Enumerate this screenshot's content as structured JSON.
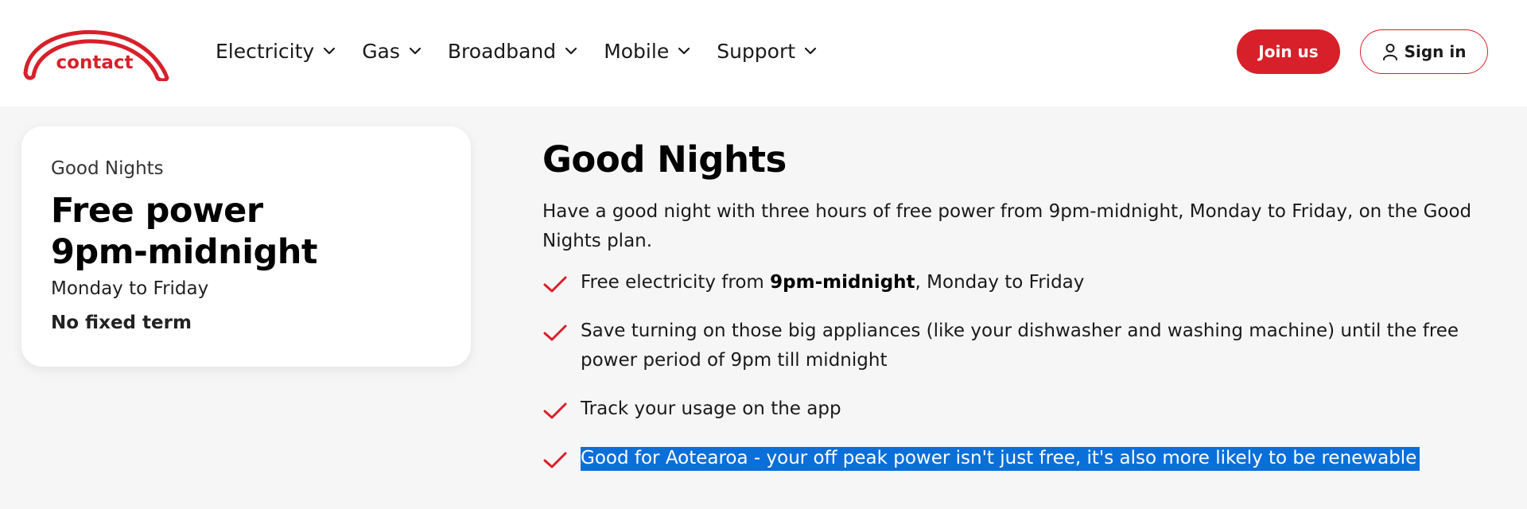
{
  "brand": {
    "logo_text": "contact",
    "accent": "#d8202a"
  },
  "nav": {
    "items": [
      {
        "label": "Electricity",
        "icon": "chevron-down-icon"
      },
      {
        "label": "Gas",
        "icon": "chevron-down-icon"
      },
      {
        "label": "Broadband",
        "icon": "chevron-down-icon"
      },
      {
        "label": "Mobile",
        "icon": "chevron-down-icon"
      },
      {
        "label": "Support",
        "icon": "chevron-down-icon"
      }
    ]
  },
  "actions": {
    "join_label": "Join us",
    "sign_in_label": "Sign in",
    "sign_in_icon": "user-icon"
  },
  "plan_card": {
    "eyebrow": "Good Nights",
    "title_line1": "Free power",
    "title_line2": "9pm-midnight",
    "days": "Monday to Friday",
    "term": "No fixed term"
  },
  "content": {
    "heading": "Good Nights",
    "intro": "Have a good night with three hours of free power from 9pm-midnight, Monday to Friday, on the Good Nights plan.",
    "benefits": [
      {
        "prefix": "Free electricity from ",
        "bold": "9pm-midnight",
        "suffix": ", Monday to Friday"
      },
      {
        "text": "Save turning on those big appliances (like your dishwasher and washing machine) until the free power period of 9pm till midnight"
      },
      {
        "text": "Track your usage on the app"
      },
      {
        "text": "Good for Aotearoa - your off peak power isn't just free, it's also more likely to be renewable",
        "selected": true
      }
    ]
  }
}
